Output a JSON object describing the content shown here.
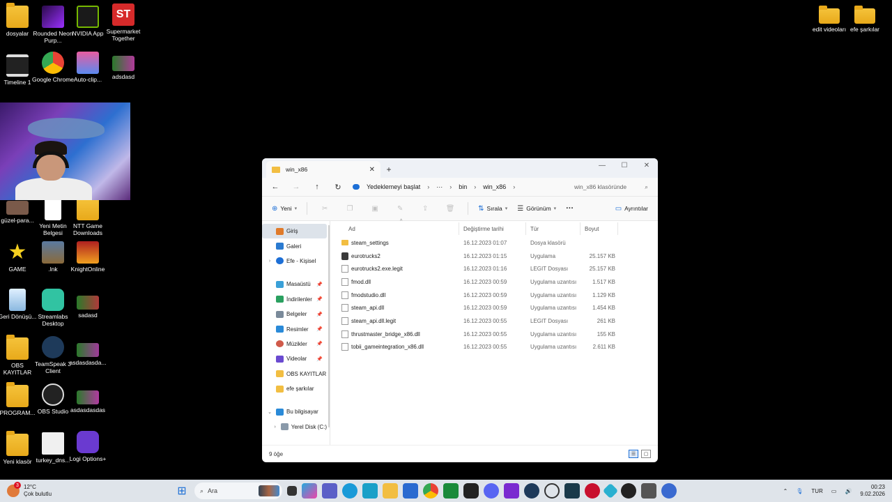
{
  "desktop": {
    "icons_left": [
      {
        "label": "dosyalar"
      },
      {
        "label": "Rounded Neon Purp..."
      },
      {
        "label": "NVIDIA App"
      },
      {
        "label": "Supermarket Together"
      },
      {
        "label": "Timeline 1"
      },
      {
        "label": "Google Chrome"
      },
      {
        "label": "Auto-clip..."
      },
      {
        "label": "adsdasd"
      },
      {
        "label": "güzel-para..."
      },
      {
        "label": "Yeni Metin Belgesi"
      },
      {
        "label": "NTT Game Downloads"
      },
      {
        "label": "GAME"
      },
      {
        "label": ".lnk"
      },
      {
        "label": "KnightOnline"
      },
      {
        "label": "Geri Dönüşü..."
      },
      {
        "label": "Streamlabs Desktop"
      },
      {
        "label": "sadasd"
      },
      {
        "label": "OBS KAYITLAR"
      },
      {
        "label": "TeamSpeak 3 Client"
      },
      {
        "label": "asdasdasda..."
      },
      {
        "label": "PROGRAM..."
      },
      {
        "label": "OBS Studio"
      },
      {
        "label": "asdasdasdas"
      },
      {
        "label": "Yeni klasör"
      },
      {
        "label": "turkey_dns..."
      },
      {
        "label": "Logi Options+"
      }
    ],
    "icons_right": [
      {
        "label": "edit videoları"
      },
      {
        "label": "efe şarkılar"
      }
    ]
  },
  "explorer": {
    "tab_title": "win_x86",
    "new_tab": "+",
    "breadcrumb": {
      "backup": "Yedeklemeyi başlat",
      "ellipsis": "···",
      "bin": "bin",
      "current": "win_x86"
    },
    "search_placeholder": "win_x86 klasöründe",
    "toolbar": {
      "new": "Yeni",
      "sort": "Sırala",
      "view": "Görünüm",
      "more": "···",
      "details": "Ayrıntılar"
    },
    "nav": {
      "home": "Giriş",
      "gallery": "Galeri",
      "personal": "Efe - Kişisel",
      "desktop": "Masaüstü",
      "downloads": "İndirilenler",
      "documents": "Belgeler",
      "pictures": "Resimler",
      "music": "Müzikler",
      "videos": "Videolar",
      "obs": "OBS KAYITLAR",
      "songs": "efe şarkılar",
      "this_pc": "Bu bilgisayar",
      "local_disk": "Yerel Disk (C:)"
    },
    "columns": {
      "name": "Ad",
      "date": "Değiştirme tarihi",
      "type": "Tür",
      "size": "Boyut"
    },
    "files": [
      {
        "name": "steam_settings",
        "date": "16.12.2023 01:07",
        "type": "Dosya klasörü",
        "size": "",
        "kind": "folder"
      },
      {
        "name": "eurotrucks2",
        "date": "16.12.2023 01:15",
        "type": "Uygulama",
        "size": "25.157 KB",
        "kind": "app"
      },
      {
        "name": "eurotrucks2.exe.legit",
        "date": "16.12.2023 01:16",
        "type": "LEGIT Dosyası",
        "size": "25.157 KB",
        "kind": "doc"
      },
      {
        "name": "fmod.dll",
        "date": "16.12.2023 00:59",
        "type": "Uygulama uzantısı",
        "size": "1.517 KB",
        "kind": "doc"
      },
      {
        "name": "fmodstudio.dll",
        "date": "16.12.2023 00:59",
        "type": "Uygulama uzantısı",
        "size": "1.129 KB",
        "kind": "doc"
      },
      {
        "name": "steam_api.dll",
        "date": "16.12.2023 00:59",
        "type": "Uygulama uzantısı",
        "size": "1.454 KB",
        "kind": "doc"
      },
      {
        "name": "steam_api.dll.legit",
        "date": "16.12.2023 00:55",
        "type": "LEGIT Dosyası",
        "size": "261 KB",
        "kind": "doc"
      },
      {
        "name": "thrustmaster_bridge_x86.dll",
        "date": "16.12.2023 00:55",
        "type": "Uygulama uzantısı",
        "size": "155 KB",
        "kind": "doc"
      },
      {
        "name": "tobii_gameintegration_x86.dll",
        "date": "16.12.2023 00:55",
        "type": "Uygulama uzantısı",
        "size": "2.611 KB",
        "kind": "doc"
      }
    ],
    "status": "9 öğe"
  },
  "taskbar": {
    "weather_badge": "3",
    "temperature": "12°C",
    "weather_desc": "Çok bulutlu",
    "search": "Ara",
    "language": "TUR",
    "time": "00:23",
    "date": "9.02.2026"
  },
  "colors": {
    "accent": "#1d6fd6",
    "folder": "#f2be42",
    "taskbar": "#dfe4ea"
  }
}
